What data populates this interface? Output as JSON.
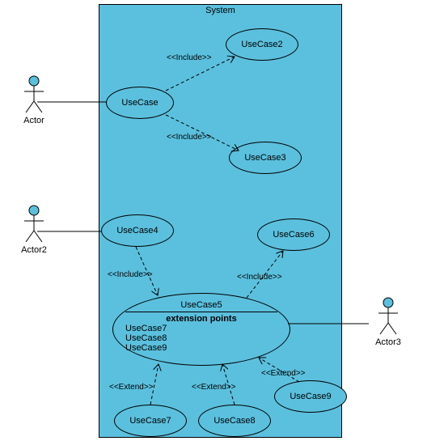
{
  "diagram": {
    "system_label": "System",
    "actors": {
      "a1": "Actor",
      "a2": "Actor2",
      "a3": "Actor3"
    },
    "usecases": {
      "uc1": "UseCase",
      "uc2": "UseCase2",
      "uc3": "UseCase3",
      "uc4": "UseCase4",
      "uc5_title": "UseCase5",
      "uc5_ep_label": "extension points",
      "uc5_ep1": "UseCase7",
      "uc5_ep2": "UseCase8",
      "uc5_ep3": "UseCase9",
      "uc6": "UseCase6",
      "uc7": "UseCase7",
      "uc8": "UseCase8",
      "uc9": "UseCase9"
    },
    "stereotypes": {
      "include": "<<Include>>",
      "extend": "<<Extend>>"
    }
  },
  "chart_data": {
    "type": "uml-use-case",
    "system": "System",
    "actors": [
      "Actor",
      "Actor2",
      "Actor3"
    ],
    "use_cases": [
      "UseCase",
      "UseCase2",
      "UseCase3",
      "UseCase4",
      "UseCase5",
      "UseCase6",
      "UseCase7",
      "UseCase8",
      "UseCase9"
    ],
    "extension_points": {
      "UseCase5": [
        "UseCase7",
        "UseCase8",
        "UseCase9"
      ]
    },
    "associations": [
      {
        "actor": "Actor",
        "use_case": "UseCase"
      },
      {
        "actor": "Actor2",
        "use_case": "UseCase4"
      },
      {
        "actor": "Actor3",
        "use_case": "UseCase5"
      }
    ],
    "includes": [
      {
        "from": "UseCase",
        "to": "UseCase2"
      },
      {
        "from": "UseCase",
        "to": "UseCase3"
      },
      {
        "from": "UseCase4",
        "to": "UseCase5"
      },
      {
        "from": "UseCase5",
        "to": "UseCase6"
      }
    ],
    "extends": [
      {
        "from": "UseCase7",
        "to": "UseCase5"
      },
      {
        "from": "UseCase8",
        "to": "UseCase5"
      },
      {
        "from": "UseCase9",
        "to": "UseCase5"
      }
    ]
  }
}
